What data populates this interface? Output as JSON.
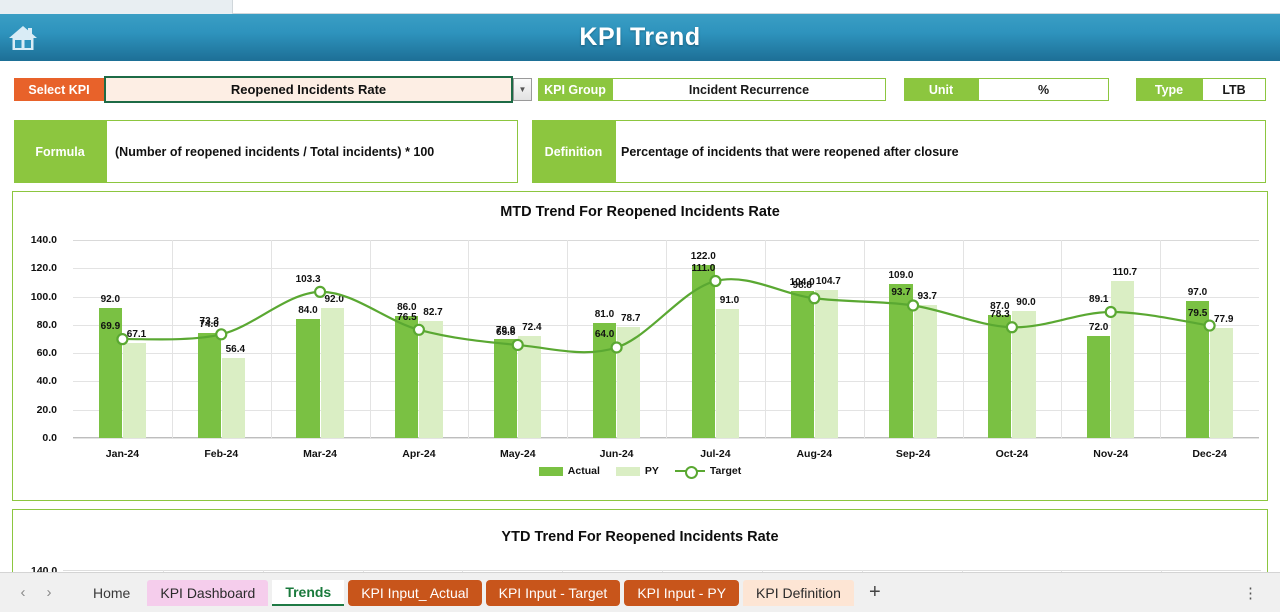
{
  "window": {
    "title": "KPI Trend",
    "home_icon": "home-icon"
  },
  "kpi_header": {
    "select_kpi_label": "Select KPI",
    "select_kpi_value": "Reopened Incidents Rate",
    "dropdown_arrow": "▼",
    "kpi_group_label": "KPI Group",
    "kpi_group_value": "Incident Recurrence",
    "unit_label": "Unit",
    "unit_value": "%",
    "type_label": "Type",
    "type_value": "LTB",
    "formula_label": "Formula",
    "formula_value": "(Number of reopened incidents / Total incidents) * 100",
    "definition_label": "Definition",
    "definition_value": "Percentage of incidents that were reopened after closure"
  },
  "ytd": {
    "title": "YTD Trend For Reopened Incidents Rate",
    "first_ytick": "140.0"
  },
  "chart_data": {
    "type": "bar",
    "title": "MTD Trend For Reopened Incidents Rate",
    "xlabel": "",
    "ylabel": "",
    "ylim": [
      0,
      140
    ],
    "yticks": [
      "0.0",
      "20.0",
      "40.0",
      "60.0",
      "80.0",
      "100.0",
      "120.0",
      "140.0"
    ],
    "grid": true,
    "legend_position": "bottom",
    "categories": [
      "Jan-24",
      "Feb-24",
      "Mar-24",
      "Apr-24",
      "May-24",
      "Jun-24",
      "Jul-24",
      "Aug-24",
      "Sep-24",
      "Oct-24",
      "Nov-24",
      "Dec-24"
    ],
    "series": [
      {
        "name": "Actual",
        "kind": "bar",
        "color": "#7ac143",
        "values": [
          92.0,
          74.0,
          84.0,
          86.0,
          70.0,
          81.0,
          122.0,
          104.0,
          109.0,
          87.0,
          72.0,
          97.0
        ],
        "labels": [
          "92.0",
          "74.0",
          "84.0",
          "86.0",
          "70.0",
          "81.0",
          "122.0",
          "104.0",
          "109.0",
          "87.0",
          "72.0",
          "97.0"
        ]
      },
      {
        "name": "PY",
        "kind": "bar",
        "color": "#daeec4",
        "values": [
          67.1,
          56.4,
          92.0,
          82.7,
          72.4,
          78.7,
          91.0,
          104.7,
          93.7,
          90.0,
          110.7,
          77.9
        ],
        "labels": [
          "67.1",
          "56.4",
          "92.0",
          "82.7",
          "72.4",
          "78.7",
          "91.0",
          "104.7",
          "93.7",
          "90.0",
          "110.7",
          "77.9"
        ]
      },
      {
        "name": "Target",
        "kind": "line",
        "color": "#5aa832",
        "values": [
          69.9,
          73.3,
          103.3,
          76.5,
          65.8,
          64.0,
          111.0,
          98.8,
          93.7,
          78.3,
          89.1,
          79.5
        ],
        "labels": [
          "69.9",
          "73.3",
          "103.3",
          "76.5",
          "65.8",
          "64.0",
          "111.0",
          "98.8",
          "93.7",
          "78.3",
          "89.1",
          "79.5"
        ]
      }
    ]
  },
  "sheet_tabs": {
    "prev_label": "‹",
    "next_label": "›",
    "add_label": "+",
    "kebab_label": "⋮",
    "items": [
      {
        "label": "Home",
        "style": "plain"
      },
      {
        "label": "KPI Dashboard",
        "style": "pink"
      },
      {
        "label": "Trends",
        "style": "active"
      },
      {
        "label": "KPI Input_ Actual",
        "style": "orange"
      },
      {
        "label": "KPI Input - Target",
        "style": "orange"
      },
      {
        "label": "KPI Input - PY",
        "style": "orange"
      },
      {
        "label": "KPI Definition",
        "style": "peach"
      }
    ]
  }
}
